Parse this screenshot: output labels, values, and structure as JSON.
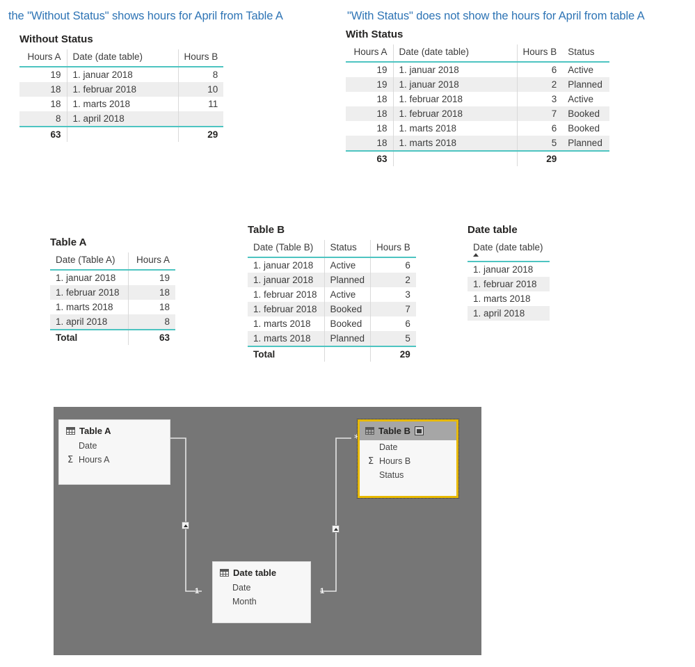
{
  "captions": {
    "left": "the \"Without Status\" shows hours for April from Table A",
    "right": "\"With Status\" does not show the hours for April from table A"
  },
  "colors": {
    "accent_teal": "#4dc4c1",
    "caption_blue": "#2e74b5",
    "row_alt": "#eeeeee",
    "canvas_gray": "#767676",
    "selection_gold": "#e8b900"
  },
  "visual_without_status": {
    "title": "Without Status",
    "columns": [
      "Hours A",
      "Date (date table)",
      "Hours B"
    ],
    "rows": [
      [
        "19",
        "1. januar 2018",
        "8"
      ],
      [
        "18",
        "1. februar 2018",
        "10"
      ],
      [
        "18",
        "1. marts 2018",
        "11"
      ],
      [
        "8",
        "1. april 2018",
        ""
      ]
    ],
    "total": [
      "63",
      "",
      "29"
    ]
  },
  "visual_with_status": {
    "title": "With Status",
    "columns": [
      "Hours A",
      "Date (date table)",
      "Hours B",
      "Status"
    ],
    "rows": [
      [
        "19",
        "1. januar 2018",
        "6",
        "Active"
      ],
      [
        "19",
        "1. januar 2018",
        "2",
        "Planned"
      ],
      [
        "18",
        "1. februar 2018",
        "3",
        "Active"
      ],
      [
        "18",
        "1. februar 2018",
        "7",
        "Booked"
      ],
      [
        "18",
        "1. marts 2018",
        "6",
        "Booked"
      ],
      [
        "18",
        "1. marts 2018",
        "5",
        "Planned"
      ]
    ],
    "total": [
      "63",
      "",
      "29",
      ""
    ]
  },
  "visual_table_a": {
    "title": "Table A",
    "columns": [
      "Date (Table A)",
      "Hours A"
    ],
    "rows": [
      [
        "1. januar 2018",
        "19"
      ],
      [
        "1. februar 2018",
        "18"
      ],
      [
        "1. marts 2018",
        "18"
      ],
      [
        "1. april 2018",
        "8"
      ]
    ],
    "total": [
      "Total",
      "63"
    ]
  },
  "visual_table_b": {
    "title": "Table B",
    "columns": [
      "Date (Table B)",
      "Status",
      "Hours B"
    ],
    "rows": [
      [
        "1. januar 2018",
        "Active",
        "6"
      ],
      [
        "1. januar 2018",
        "Planned",
        "2"
      ],
      [
        "1. februar 2018",
        "Active",
        "3"
      ],
      [
        "1. februar 2018",
        "Booked",
        "7"
      ],
      [
        "1. marts 2018",
        "Booked",
        "6"
      ],
      [
        "1. marts 2018",
        "Planned",
        "5"
      ]
    ],
    "total": [
      "Total",
      "",
      "29"
    ]
  },
  "visual_date_table": {
    "title": "Date table",
    "columns": [
      "Date (date table)"
    ],
    "sort": "ascending",
    "rows": [
      [
        "1. januar 2018"
      ],
      [
        "1. februar 2018"
      ],
      [
        "1. marts 2018"
      ],
      [
        "1. april 2018"
      ]
    ]
  },
  "model": {
    "cards": [
      {
        "name": "Table A",
        "selected": false,
        "fields": [
          {
            "label": "Date",
            "aggregate": false
          },
          {
            "label": "Hours A",
            "aggregate": true
          }
        ]
      },
      {
        "name": "Table B",
        "selected": true,
        "expand_icon": "expand-icon",
        "fields": [
          {
            "label": "Date",
            "aggregate": false
          },
          {
            "label": "Hours B",
            "aggregate": true
          },
          {
            "label": "Status",
            "aggregate": false
          }
        ]
      },
      {
        "name": "Date table",
        "selected": false,
        "fields": [
          {
            "label": "Date",
            "aggregate": false
          },
          {
            "label": "Month",
            "aggregate": false
          }
        ]
      }
    ],
    "relationships": [
      {
        "from": "Table A",
        "from_cardinality": "*",
        "to": "Date table",
        "to_cardinality": "1"
      },
      {
        "from": "Table B",
        "from_cardinality": "*",
        "to": "Date table",
        "to_cardinality": "1"
      }
    ]
  }
}
